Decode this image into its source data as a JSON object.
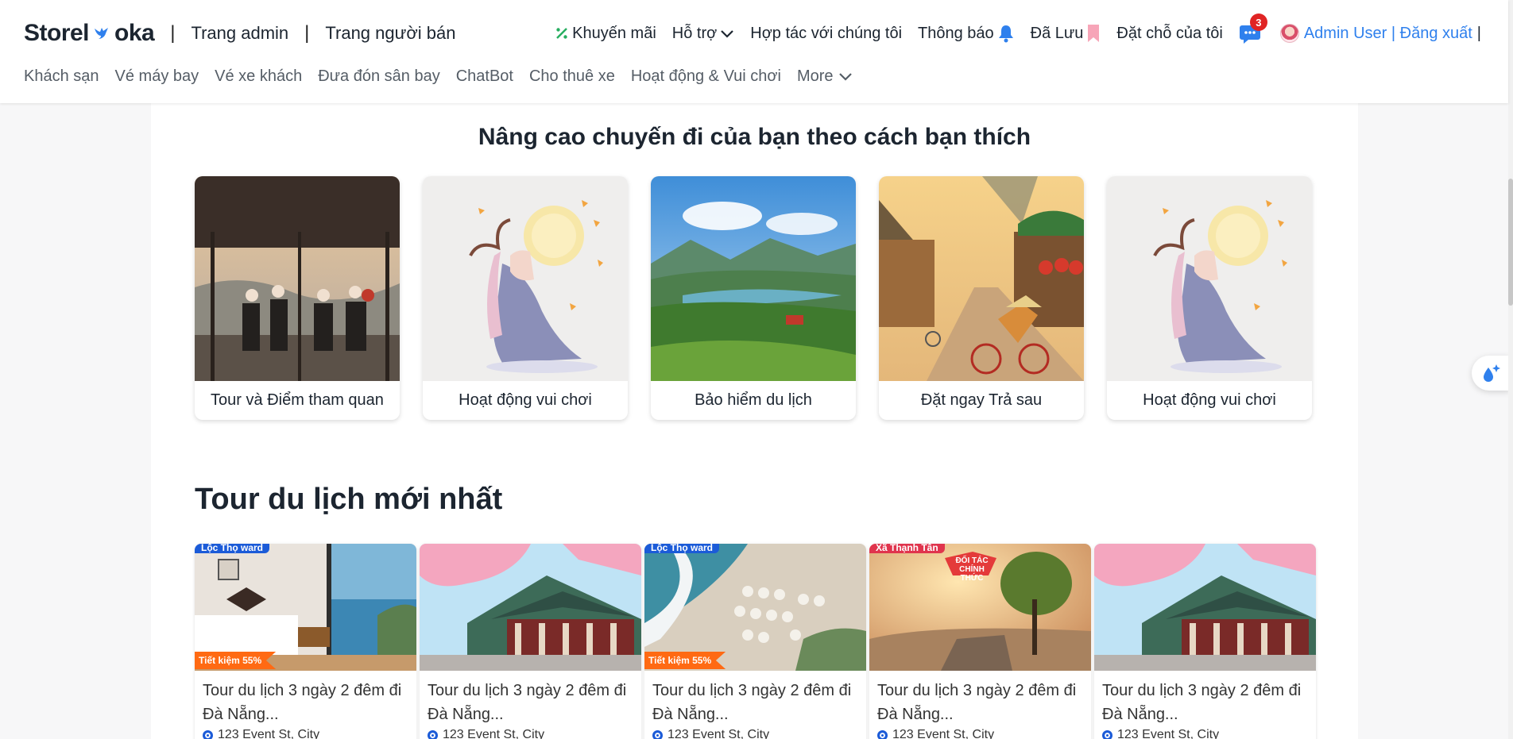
{
  "brand": {
    "part1": "Storel",
    "part2": "oka"
  },
  "top_links": {
    "admin": "Trang admin",
    "seller": "Trang người bán",
    "separator": "|"
  },
  "right_nav": {
    "promo": "Khuyến mãi",
    "support": "Hỗ trợ",
    "partner": "Hợp tác với chúng tôi",
    "notify": "Thông báo",
    "saved": "Đã Lưu",
    "bookings": "Đặt chỗ của tôi",
    "chat_badge": "3",
    "user": "Admin User | Đăng xuất",
    "cursor": "|"
  },
  "sub_nav": [
    "Khách sạn",
    "Vé máy bay",
    "Vé xe khách",
    "Đưa đón sân bay",
    "ChatBot",
    "Cho thuê xe",
    "Hoạt động & Vui chơi",
    "More"
  ],
  "section": {
    "title": "Nâng cao chuyến đi của bạn theo cách bạn thích"
  },
  "categories": [
    {
      "label": "Tour và Điểm tham quan",
      "image": "tour-scene"
    },
    {
      "label": "Hoạt động vui chơi",
      "image": "moon-fairy"
    },
    {
      "label": "Bảo hiểm du lịch",
      "image": "valley-landscape"
    },
    {
      "label": "Đặt ngay Trả sau",
      "image": "village-street"
    },
    {
      "label": "Hoạt động vui chơi",
      "image": "moon-fairy"
    }
  ],
  "tours_section": {
    "title": "Tour du lịch mới nhất"
  },
  "tours": [
    {
      "location": "Lộc Thọ ward",
      "discount": "Tiết kiệm 55%",
      "name": "Tour du lịch 3 ngày 2 đêm đi Đà Nẵng...",
      "address": "123 Event St, City",
      "image": "hotel-room"
    },
    {
      "location": "",
      "discount": "",
      "name": "Tour du lịch 3 ngày 2 đêm đi Đà Nẵng...",
      "address": "123 Event St, City",
      "image": "cherry-temple"
    },
    {
      "location": "Lộc Thọ ward",
      "discount": "Tiết kiệm 55%",
      "name": "Tour du lịch 3 ngày 2 đêm đi Đà Nẵng...",
      "address": "123 Event St, City",
      "image": "beach"
    },
    {
      "location": "Xã Thạnh Tân",
      "discount": "",
      "name": "Tour du lịch 3 ngày 2 đêm đi Đà Nẵng...",
      "address": "123 Event St, City",
      "image": "mountain-partner",
      "overlay": "ĐỐI TÁC CHÍNH THỨC"
    },
    {
      "location": "",
      "discount": "",
      "name": "Tour du lịch 3 ngày 2 đêm đi Đà Nẵng...",
      "address": "123 Event St, City",
      "image": "cherry-temple"
    }
  ]
}
